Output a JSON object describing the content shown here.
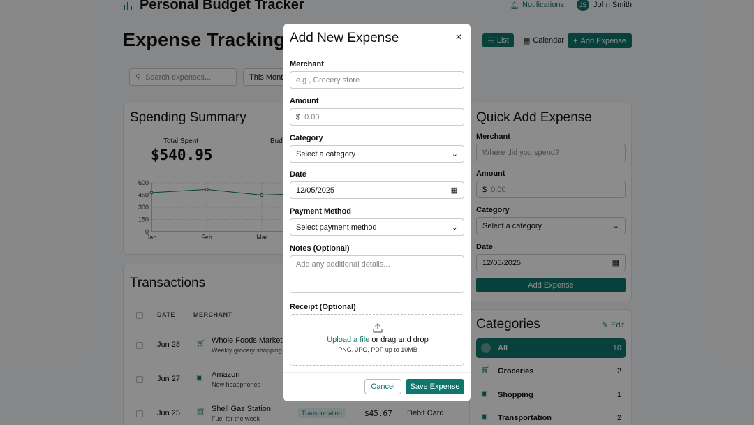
{
  "app": {
    "title": "Personal Budget Tracker"
  },
  "header": {
    "notifications": "Notifications",
    "user_initials": "JS",
    "user_name": "John Smith"
  },
  "page": {
    "title": "Expense Tracking"
  },
  "view": {
    "list": "List",
    "calendar": "Calendar",
    "add": "Add Expense"
  },
  "filters": {
    "search_placeholder": "Search expenses...",
    "period": "This Month"
  },
  "summary": {
    "title": "Spending Summary",
    "total_label": "Total Spent",
    "total_value": "$540.95",
    "budget_label": "Budg",
    "chart": {
      "y_ticks": [
        "600",
        "450",
        "300",
        "150",
        "0"
      ],
      "x_ticks": [
        "Jan",
        "Feb",
        "Mar"
      ]
    }
  },
  "chart_data": {
    "type": "line",
    "x": [
      "Jan",
      "Feb",
      "Mar"
    ],
    "series": [
      {
        "values": [
          480,
          520,
          450
        ]
      }
    ],
    "ylim": [
      0,
      600
    ],
    "yticks": [
      0,
      150,
      300,
      450,
      600
    ],
    "grid": true
  },
  "transactions": {
    "title": "Transactions",
    "headers": {
      "date": "DATE",
      "merchant": "MERCHANT"
    },
    "rows": [
      {
        "date": "Jun 28",
        "merchant": "Whole Foods Market",
        "sub": "Weekly grocery shopping",
        "category": "",
        "amount": "",
        "method": ""
      },
      {
        "date": "Jun 27",
        "merchant": "Amazon",
        "sub": "New headphones",
        "category": "",
        "amount": "",
        "method": ""
      },
      {
        "date": "Jun 25",
        "merchant": "Shell Gas Station",
        "sub": "Fuel for the week",
        "category": "Transportation",
        "amount": "$45.67",
        "method": "Debit Card"
      }
    ]
  },
  "quick": {
    "title": "Quick Add Expense",
    "merchant_label": "Merchant",
    "merchant_placeholder": "Where did you spend?",
    "amount_label": "Amount",
    "amount_prefix": "$",
    "amount_placeholder": "0.00",
    "category_label": "Category",
    "category_value": "Select a category",
    "date_label": "Date",
    "date_value": "12/05/2025",
    "button": "Add Expense"
  },
  "categories": {
    "title": "Categories",
    "edit": "Edit",
    "items": [
      {
        "name": "All",
        "count": "10"
      },
      {
        "name": "Groceries",
        "count": "2"
      },
      {
        "name": "Shopping",
        "count": "1"
      },
      {
        "name": "Transportation",
        "count": "2"
      }
    ]
  },
  "modal": {
    "title": "Add New Expense",
    "merchant_label": "Merchant",
    "merchant_placeholder": "e.g., Grocery store",
    "amount_label": "Amount",
    "amount_prefix": "$",
    "amount_placeholder": "0.00",
    "category_label": "Category",
    "category_value": "Select a category",
    "date_label": "Date",
    "date_value": "12/05/2025",
    "payment_label": "Payment Method",
    "payment_value": "Select payment method",
    "notes_label": "Notes (Optional)",
    "notes_placeholder": "Add any additional details...",
    "receipt_label": "Receipt (Optional)",
    "upload_link": "Upload a file",
    "upload_rest": " or drag and drop",
    "upload_hint": "PNG, JPG, PDF up to 10MB",
    "cancel": "Cancel",
    "save": "Save Expense"
  },
  "colors": {
    "accent": "#0f766e",
    "overlay": "rgba(0,0,0,0.45)"
  }
}
